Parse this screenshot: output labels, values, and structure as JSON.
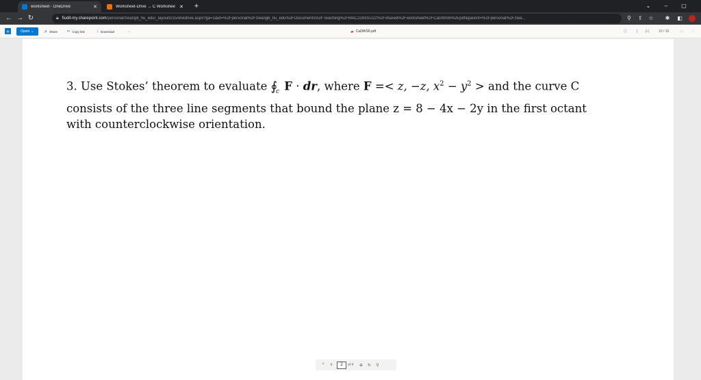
{
  "browser": {
    "tabs": [
      {
        "title": "worksheet - OneDrive",
        "favicon_color": "#0078d4",
        "active": true
      },
      {
        "title": "Worksheet-Drive → C Worksheet",
        "favicon_color": "#e8710a",
        "active": false
      }
    ],
    "url_host": "fiudit-my.sharepoint.com",
    "url_path": "/personal/zwang6_fiu_edu/_layouts/15/onedrive.aspx?ga=1&id=%2Fpersonal%2Fzwang6_fiu_edu%2FDocuments%2FTeaching%2FMAC2283SU22%2Fshared%2Fworksheet%2FCal3WS6%2Epdf&parent=%2Fpersonal%2Fzwa..."
  },
  "viewer": {
    "open_label": "Open",
    "share_label": "Share",
    "copy_link_label": "Copy link",
    "download_label": "Download",
    "more_label": "···",
    "file_name": "Cal3WS6.pdf",
    "page_counter": "10 / 10"
  },
  "document": {
    "problem_number": "3.",
    "line1_lead": "Use Stokes’ theorem to evaluate",
    "integral_symbol": "∮",
    "integral_sub": "c",
    "field_letter": "F",
    "dot_op": "·",
    "dr": "dr",
    "where_text": ", where",
    "field_def_open": "=< z, −z, x",
    "sq": "2",
    "minus_y": " − y",
    "field_def_close": " > and the curve C",
    "line2": "consists of the three line segments that bound the plane z = 8 − 4x − 2y in the first octant",
    "line3": "with counterclockwise orientation."
  },
  "pagenav": {
    "up": "^",
    "down": "v",
    "current_page": "2",
    "of_label": "of 4",
    "zoom_in": "⊕",
    "rotate": "↻",
    "search": "⚲"
  }
}
